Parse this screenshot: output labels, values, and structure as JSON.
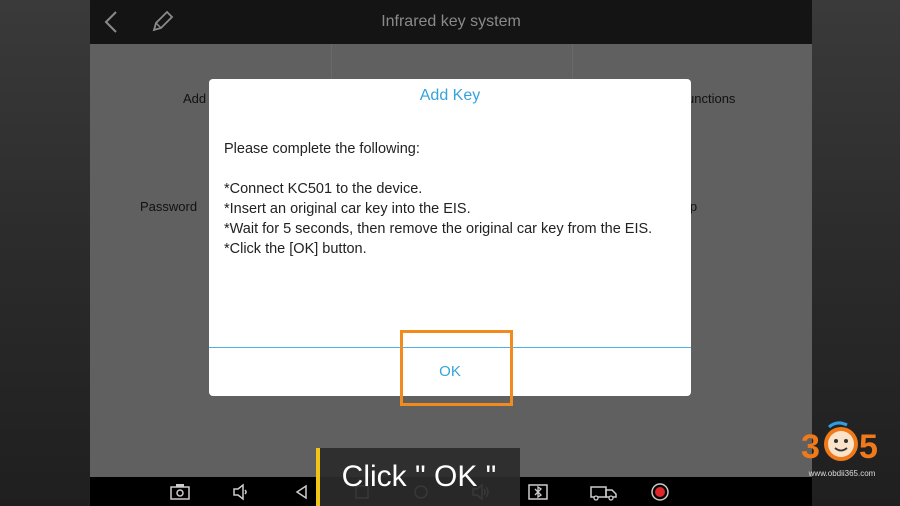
{
  "app": {
    "title": "Infrared key system"
  },
  "background_menu": {
    "items": [
      {
        "label": "Add"
      },
      {
        "label": "unctions"
      },
      {
        "label": "Password"
      },
      {
        "label": "lp"
      }
    ]
  },
  "dialog": {
    "title": "Add Key",
    "intro": "Please complete the following:",
    "steps": [
      "*Connect KC501 to the device.",
      "*Insert an original car key into the EIS.",
      "*Wait for 5 seconds, then remove the original car key from the EIS.",
      "*Click the [OK] button."
    ],
    "ok_label": "OK"
  },
  "overlay": {
    "caption": "Click \" OK \"",
    "highlight_color": "#f28b1e",
    "caption_bar_color": "#f0c419"
  },
  "watermark": {
    "logo_text": "365",
    "url": "www.obdii365.com"
  },
  "navbar": {
    "icons": [
      "screenshot-icon",
      "volume-down-icon",
      "back-icon",
      "home-icon",
      "recents-icon",
      "volume-up-icon",
      "bluetooth-icon",
      "truck-icon",
      "record-icon"
    ]
  },
  "colors": {
    "accent": "#35a3dc",
    "highlight": "#f28b1e"
  }
}
